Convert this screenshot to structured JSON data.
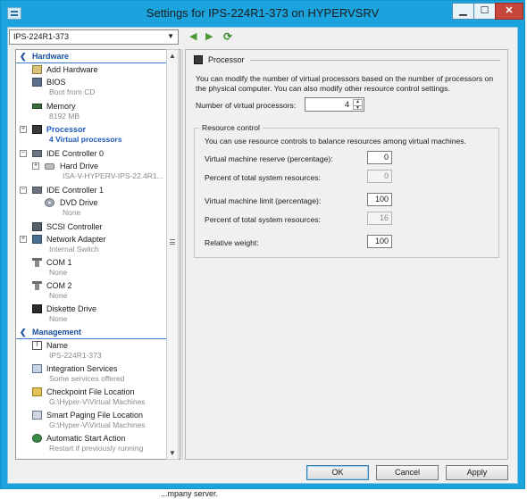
{
  "window": {
    "title": "Settings for IPS-224R1-373 on HYPERVSRV",
    "buttons": {
      "minimize": "▁",
      "maximize": "☐",
      "close": "✕"
    }
  },
  "vm_selector": {
    "selected": "IPS-224R1-373"
  },
  "nav": {
    "back": "◀",
    "forward": "▶",
    "refresh": "⟳"
  },
  "tree": {
    "hardware_header": "Hardware",
    "management_header": "Management",
    "items": [
      {
        "label": "Add Hardware",
        "sub": ""
      },
      {
        "label": "BIOS",
        "sub": "Boot from CD"
      },
      {
        "label": "Memory",
        "sub": "8192 MB"
      },
      {
        "label": "Processor",
        "sub": "4 Virtual processors"
      },
      {
        "label": "IDE Controller 0",
        "sub": ""
      },
      {
        "label": "Hard Drive",
        "sub": "ISA-V-HYPERV-IPS-22.4R1..."
      },
      {
        "label": "IDE Controller 1",
        "sub": ""
      },
      {
        "label": "DVD Drive",
        "sub": "None"
      },
      {
        "label": "SCSI Controller",
        "sub": ""
      },
      {
        "label": "Network Adapter",
        "sub": "Internal Switch"
      },
      {
        "label": "COM 1",
        "sub": "None"
      },
      {
        "label": "COM 2",
        "sub": "None"
      },
      {
        "label": "Diskette Drive",
        "sub": "None"
      }
    ],
    "mgmt_items": [
      {
        "label": "Name",
        "sub": "IPS-224R1-373"
      },
      {
        "label": "Integration Services",
        "sub": "Some services offered"
      },
      {
        "label": "Checkpoint File Location",
        "sub": "G:\\Hyper-V\\Virtual Machines"
      },
      {
        "label": "Smart Paging File Location",
        "sub": "G:\\Hyper-V\\Virtual Machines"
      },
      {
        "label": "Automatic Start Action",
        "sub": "Restart if previously running"
      }
    ]
  },
  "processor": {
    "header": "Processor",
    "description": "You can modify the number of virtual processors based on the number of processors on the physical computer. You can also modify other resource control settings.",
    "num_label": "Number of virtual processors:",
    "num_value": "4",
    "resource_control": {
      "title": "Resource control",
      "description": "You can use resource controls to balance resources among virtual machines.",
      "reserve_label": "Virtual machine reserve (percentage):",
      "reserve_value": "0",
      "reserve_pct_label": "Percent of total system resources:",
      "reserve_pct_value": "0",
      "limit_label": "Virtual machine limit (percentage):",
      "limit_value": "100",
      "limit_pct_label": "Percent of total system resources:",
      "limit_pct_value": "16",
      "weight_label": "Relative weight:",
      "weight_value": "100"
    }
  },
  "footer": {
    "ok": "OK",
    "cancel": "Cancel",
    "apply": "Apply"
  },
  "under_text": "...mpany server."
}
